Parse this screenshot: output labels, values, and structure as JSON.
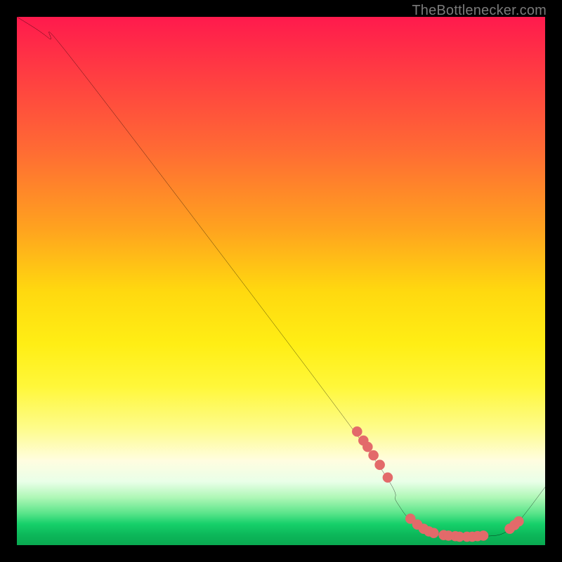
{
  "watermark": "TheBottlenecker.com",
  "chart_data": {
    "type": "line",
    "title": "",
    "xlabel": "",
    "ylabel": "",
    "xlim": [
      0,
      100
    ],
    "ylim": [
      0,
      100
    ],
    "series": [
      {
        "name": "curve",
        "x": [
          0,
          6,
          12,
          65,
          72,
          75,
          80,
          83,
          86,
          89,
          92,
          95,
          100
        ],
        "y": [
          100,
          96,
          90,
          20,
          8,
          4.5,
          2.2,
          1.7,
          1.6,
          1.7,
          2.2,
          4.5,
          11
        ]
      }
    ],
    "markers": [
      {
        "x": 64.4,
        "y": 21.5
      },
      {
        "x": 65.6,
        "y": 19.8
      },
      {
        "x": 66.4,
        "y": 18.6
      },
      {
        "x": 67.5,
        "y": 17.0
      },
      {
        "x": 68.7,
        "y": 15.2
      },
      {
        "x": 70.2,
        "y": 12.8
      },
      {
        "x": 74.5,
        "y": 5.0
      },
      {
        "x": 75.8,
        "y": 3.9
      },
      {
        "x": 77.0,
        "y": 3.1
      },
      {
        "x": 78.0,
        "y": 2.6
      },
      {
        "x": 78.9,
        "y": 2.3
      },
      {
        "x": 80.8,
        "y": 1.9
      },
      {
        "x": 81.7,
        "y": 1.8
      },
      {
        "x": 83.0,
        "y": 1.7
      },
      {
        "x": 83.8,
        "y": 1.6
      },
      {
        "x": 85.2,
        "y": 1.6
      },
      {
        "x": 86.2,
        "y": 1.6
      },
      {
        "x": 87.2,
        "y": 1.7
      },
      {
        "x": 88.3,
        "y": 1.8
      },
      {
        "x": 93.3,
        "y": 3.1
      },
      {
        "x": 94.2,
        "y": 3.8
      },
      {
        "x": 95.0,
        "y": 4.5
      }
    ],
    "colors": {
      "curve": "#000000",
      "marker_fill": "#e36a6a",
      "marker_stroke": "#e36a6a"
    }
  }
}
